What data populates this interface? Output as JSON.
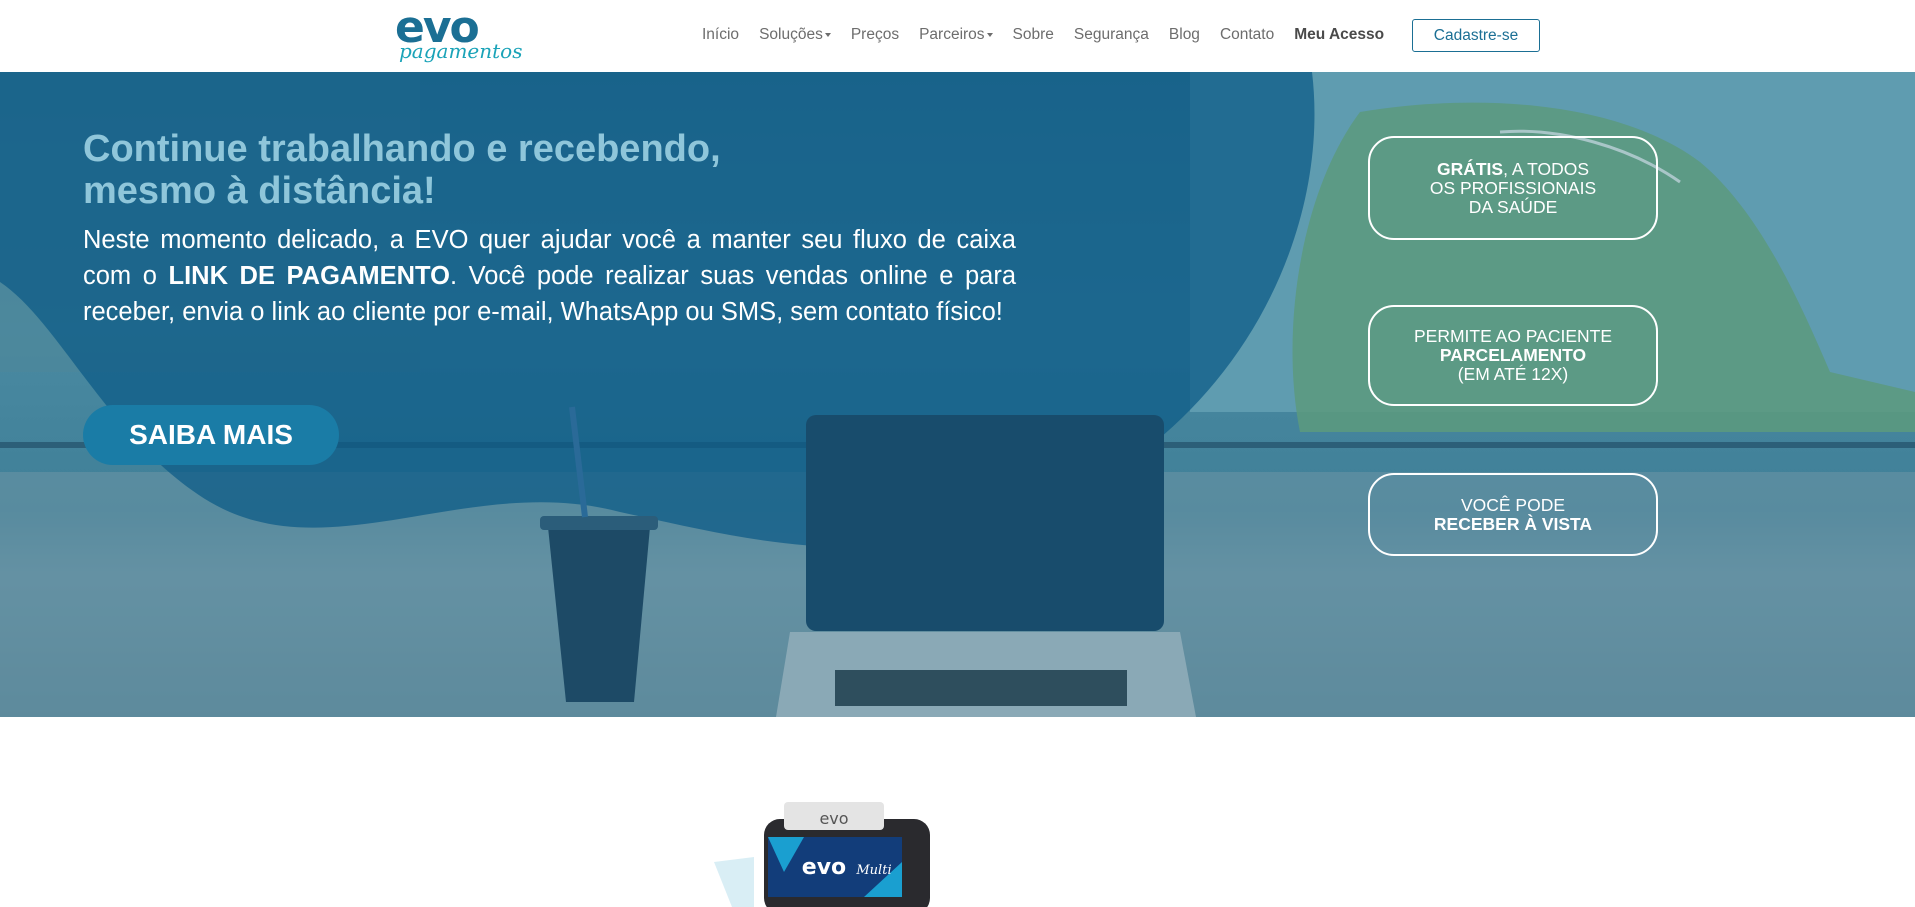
{
  "header": {
    "logo": {
      "brand": "evo",
      "sub": "pagamentos",
      "colors": {
        "primary": "#1b6f94",
        "secondary": "#1aa3b8"
      }
    },
    "nav": [
      {
        "label": "Início",
        "dropdown": false,
        "bold": false
      },
      {
        "label": "Soluções",
        "dropdown": true,
        "bold": false
      },
      {
        "label": "Preços",
        "dropdown": false,
        "bold": false
      },
      {
        "label": "Parceiros",
        "dropdown": true,
        "bold": false
      },
      {
        "label": "Sobre",
        "dropdown": false,
        "bold": false
      },
      {
        "label": "Segurança",
        "dropdown": false,
        "bold": false
      },
      {
        "label": "Blog",
        "dropdown": false,
        "bold": false
      },
      {
        "label": "Contato",
        "dropdown": false,
        "bold": false
      },
      {
        "label": "Meu Acesso",
        "dropdown": false,
        "bold": true
      }
    ],
    "signup_label": "Cadastre-se"
  },
  "hero": {
    "title_line1": "Continue trabalhando e recebendo,",
    "title_line2": "mesmo à distância!",
    "text_before": "Neste momento delicado, a EVO quer ajudar você a manter seu fluxo de caixa com o ",
    "text_bold": "LINK DE PAGAMENTO",
    "text_after": ". Você pode realizar suas vendas online e para receber, envia o link ao cliente por e-mail, WhatsApp ou SMS, sem contato físico!",
    "cta_label": "SAIBA MAIS",
    "features": [
      {
        "bold": "GRÁTIS",
        "line1_rest": ", A TODOS",
        "line2": "OS PROFISSIONAIS",
        "line3": "DA SAÚDE"
      },
      {
        "line1": "PERMITE AO PACIENTE",
        "bold": "PARCELAMENTO",
        "line3": "(EM ATÉ 12X)"
      },
      {
        "line1": "VOCÊ PODE",
        "bold": "RECEBER À VISTA"
      }
    ],
    "colors": {
      "title": "#8fc6da",
      "cta": "#1a7ca6",
      "overlay": "#0b5a86"
    }
  },
  "below": {
    "terminal_label": "evo",
    "screen_label": "evo",
    "screen_sub": "Multi"
  }
}
